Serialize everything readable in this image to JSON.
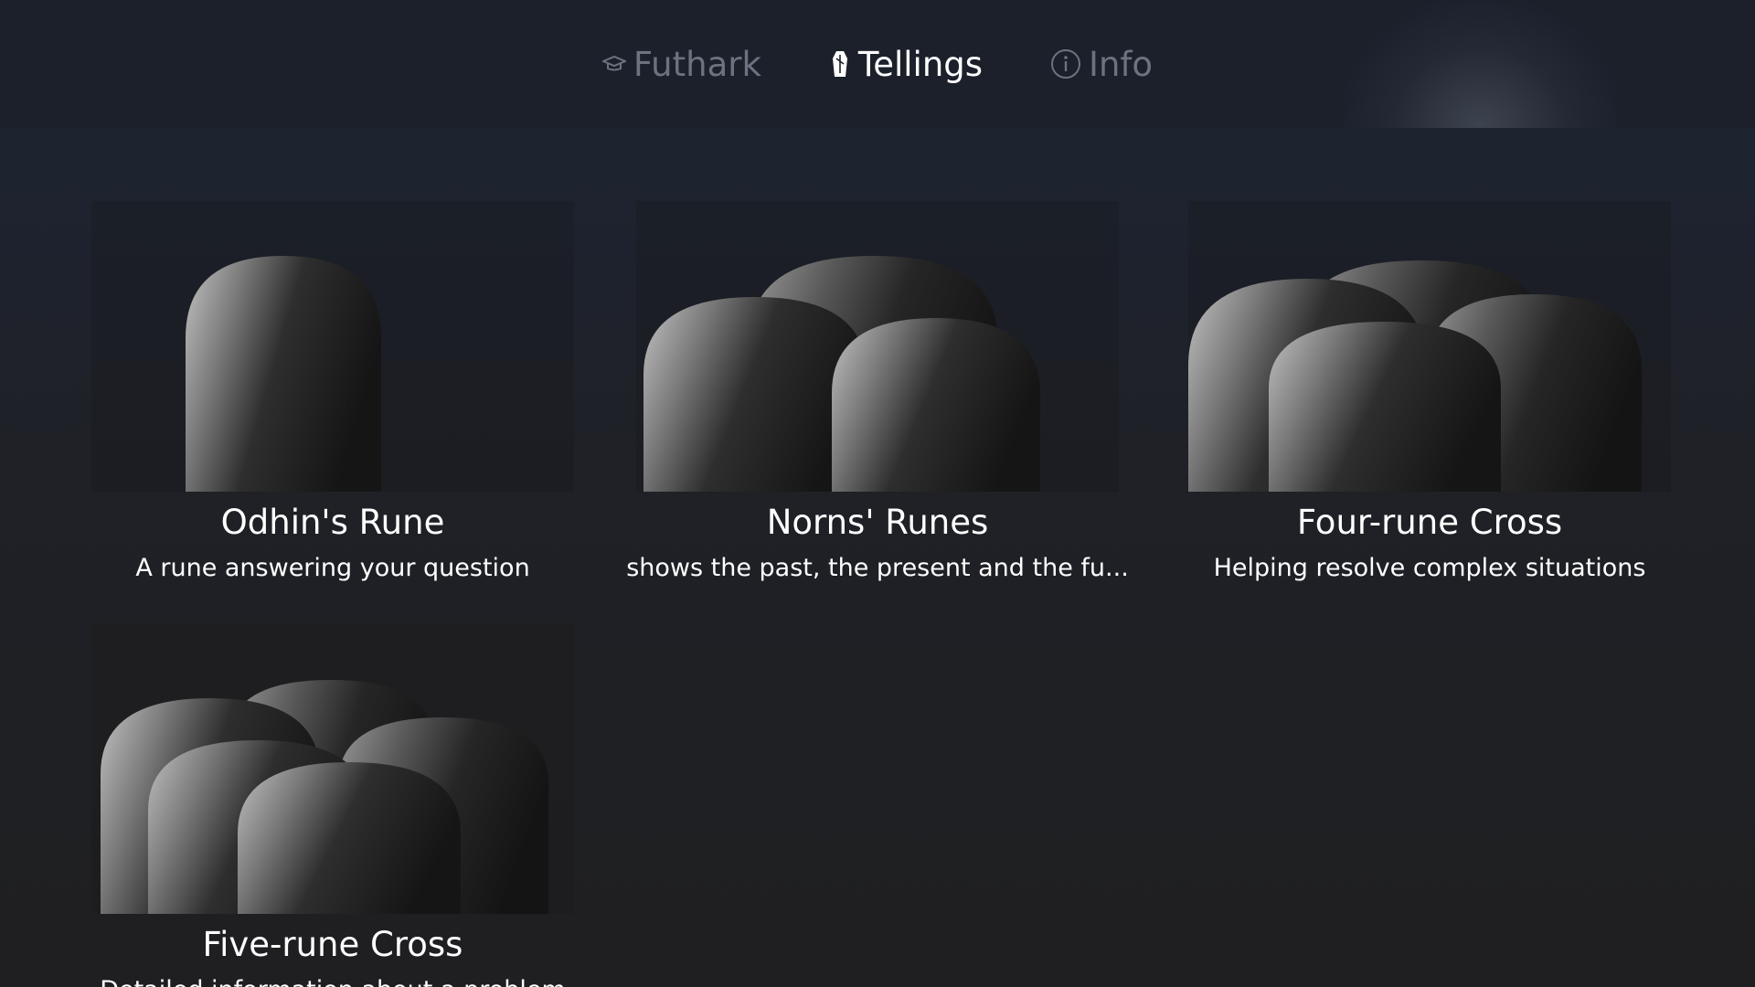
{
  "nav": {
    "items": [
      {
        "label": "Futhark",
        "icon": "graduation-cap-icon",
        "active": false
      },
      {
        "label": "Tellings",
        "icon": "rune-stone-icon",
        "active": true
      },
      {
        "label": "Info",
        "icon": "info-icon",
        "active": false
      }
    ]
  },
  "tellings": [
    {
      "title": "Odhin's Rune",
      "subtitle": "A rune answering your question"
    },
    {
      "title": "Norns' Runes",
      "subtitle": "shows the past, the present and the fu..."
    },
    {
      "title": "Four-rune Cross",
      "subtitle": "Helping resolve complex situations"
    },
    {
      "title": "Five-rune Cross",
      "subtitle": "Detailed information about a problem"
    }
  ],
  "colors": {
    "nav_inactive": "#6d7280",
    "nav_active": "#ffffff",
    "topbar": "#1b202b",
    "background": "#1f1f21"
  }
}
